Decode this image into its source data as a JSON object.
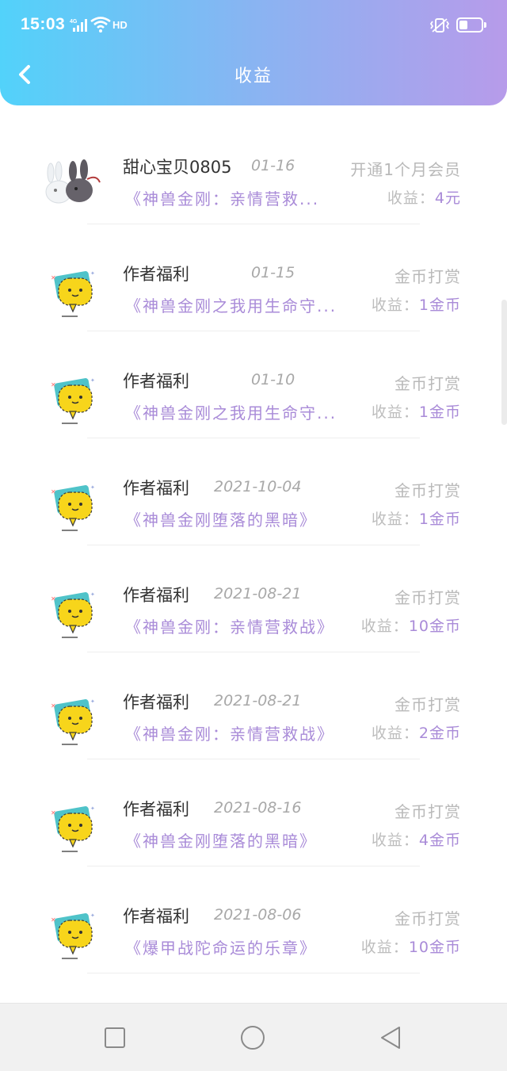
{
  "status_bar": {
    "time": "15:03",
    "network": "4G",
    "hd": "HD",
    "icons": [
      "signal-icon",
      "wifi-icon",
      "vibrate-icon",
      "battery-icon"
    ]
  },
  "header": {
    "title": "收益",
    "back_icon": "chevron-left-icon"
  },
  "colors": {
    "gradient_start": "#52d2fa",
    "gradient_end": "#b79bea",
    "accent": "#a98bd8",
    "muted": "#b9b9b9"
  },
  "items": [
    {
      "avatar": "rabbit-avatar",
      "name": "甜心宝贝0805",
      "date": "01-16",
      "type": "开通1个月会员",
      "book": "《神兽金刚：亲情营救...",
      "earnings_label": "收益：",
      "earnings_value": "4元"
    },
    {
      "avatar": "chat-bubble-avatar",
      "name": "作者福利",
      "date": "01-15",
      "type": "金币打赏",
      "book": "《神兽金刚之我用生命守...",
      "earnings_label": "收益：",
      "earnings_value": "1金币"
    },
    {
      "avatar": "chat-bubble-avatar",
      "name": "作者福利",
      "date": "01-10",
      "type": "金币打赏",
      "book": "《神兽金刚之我用生命守...",
      "earnings_label": "收益：",
      "earnings_value": "1金币"
    },
    {
      "avatar": "chat-bubble-avatar",
      "name": "作者福利",
      "date": "2021-10-04",
      "type": "金币打赏",
      "book": "《神兽金刚堕落的黑暗》",
      "earnings_label": "收益：",
      "earnings_value": "1金币"
    },
    {
      "avatar": "chat-bubble-avatar",
      "name": "作者福利",
      "date": "2021-08-21",
      "type": "金币打赏",
      "book": "《神兽金刚：亲情营救战》",
      "earnings_label": "收益：",
      "earnings_value": "10金币"
    },
    {
      "avatar": "chat-bubble-avatar",
      "name": "作者福利",
      "date": "2021-08-21",
      "type": "金币打赏",
      "book": "《神兽金刚：亲情营救战》",
      "earnings_label": "收益：",
      "earnings_value": "2金币"
    },
    {
      "avatar": "chat-bubble-avatar",
      "name": "作者福利",
      "date": "2021-08-16",
      "type": "金币打赏",
      "book": "《神兽金刚堕落的黑暗》",
      "earnings_label": "收益：",
      "earnings_value": "4金币"
    },
    {
      "avatar": "chat-bubble-avatar",
      "name": "作者福利",
      "date": "2021-08-06",
      "type": "金币打赏",
      "book": "《爆甲战陀命运的乐章》",
      "earnings_label": "收益：",
      "earnings_value": "10金币"
    }
  ],
  "navbar": {
    "buttons": [
      "recent-apps-icon",
      "home-icon",
      "back-triangle-icon"
    ]
  }
}
